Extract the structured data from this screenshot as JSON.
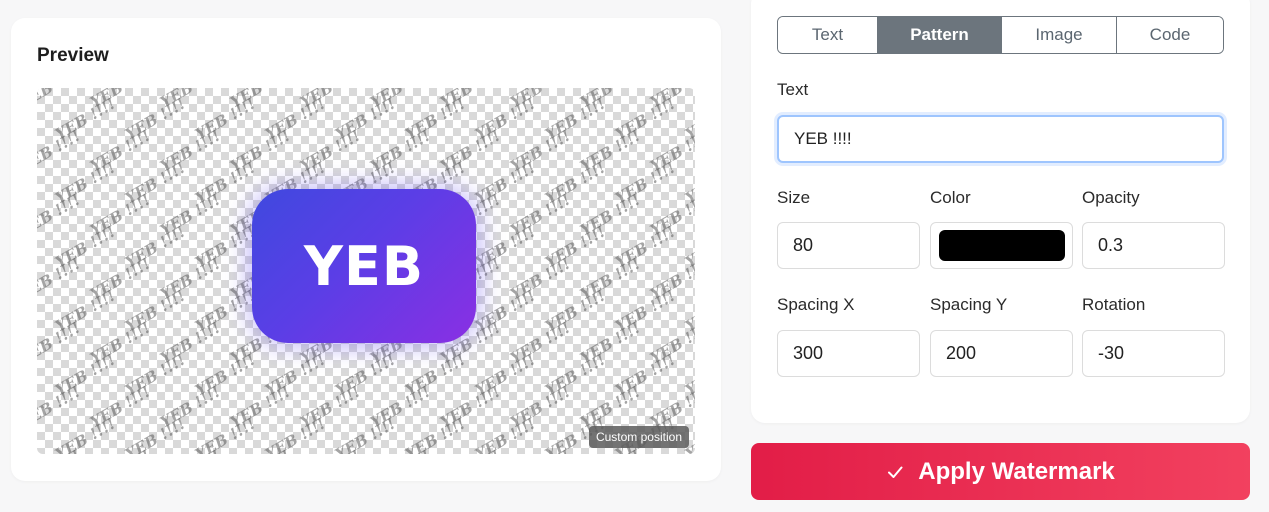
{
  "preview": {
    "title": "Preview",
    "logo_text": "YEB",
    "badge": "Custom position",
    "watermark_text": "YEB !!!!"
  },
  "settings": {
    "tabs": [
      {
        "label": "Text",
        "active": false
      },
      {
        "label": "Pattern",
        "active": true
      },
      {
        "label": "Image",
        "active": false
      },
      {
        "label": "Code",
        "active": false
      }
    ],
    "text_label": "Text",
    "text_value": "YEB !!!!",
    "size_label": "Size",
    "size_value": "80",
    "color_label": "Color",
    "color_value": "#000000",
    "opacity_label": "Opacity",
    "opacity_value": "0.3",
    "spacing_x_label": "Spacing X",
    "spacing_x_value": "300",
    "spacing_y_label": "Spacing Y",
    "spacing_y_value": "200",
    "rotation_label": "Rotation",
    "rotation_value": "-30"
  },
  "apply_button": {
    "label": "Apply Watermark",
    "icon": "check-icon"
  },
  "colors": {
    "accent_red": "#e21d47",
    "segment_active": "#6c757d",
    "logo_gradient_start": "#3f49df",
    "logo_gradient_end": "#8a2fe3"
  }
}
